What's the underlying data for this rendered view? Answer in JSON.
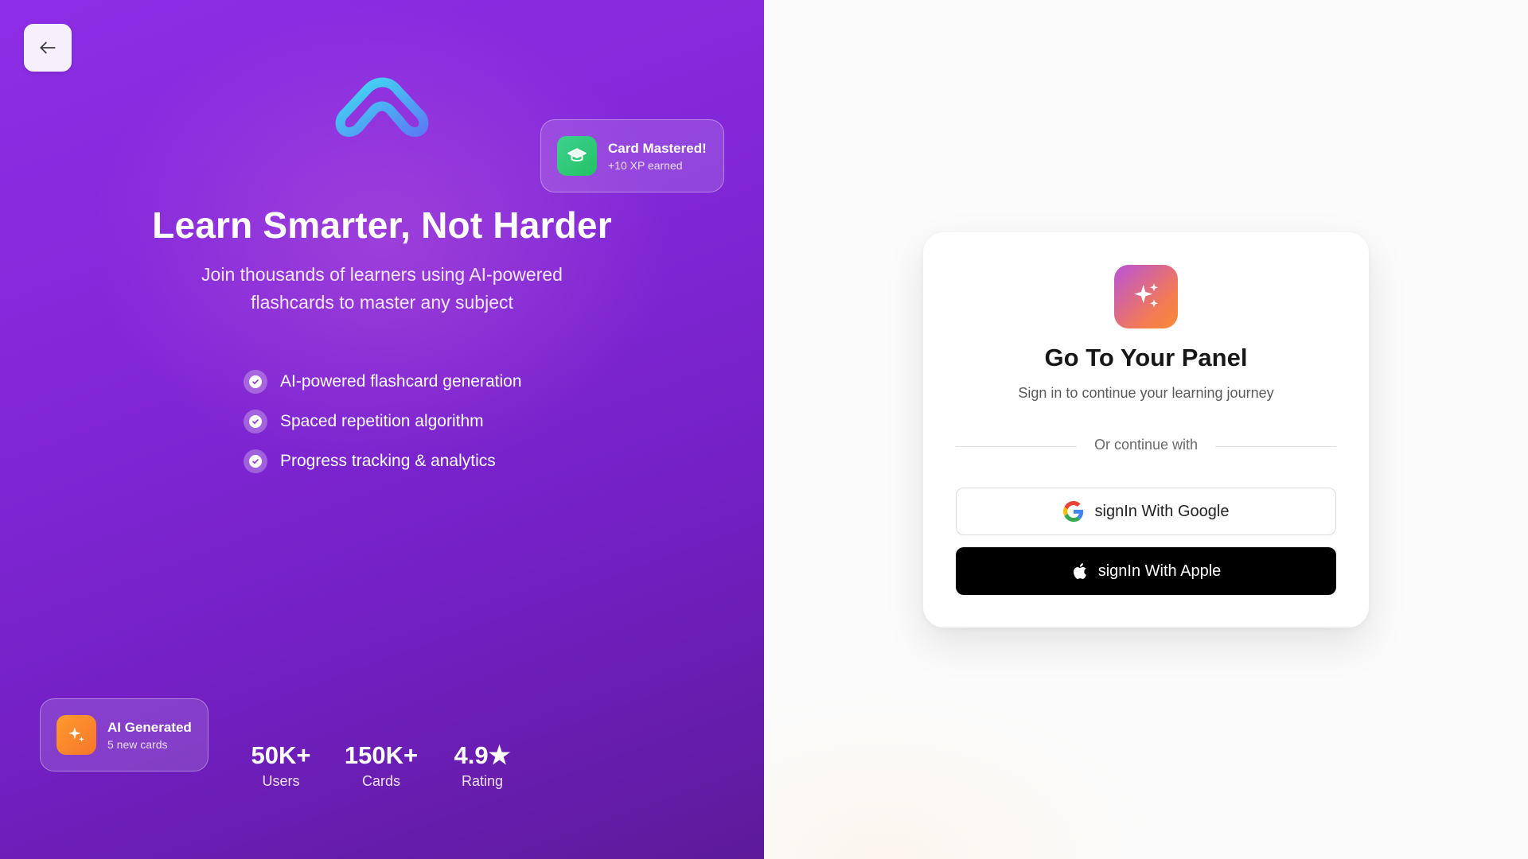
{
  "hero": {
    "headline": "Learn Smarter, Not Harder",
    "subline": "Join thousands of learners using AI-powered flashcards to master any subject",
    "features": [
      "AI-powered flashcard generation",
      "Spaced repetition algorithm",
      "Progress tracking & analytics"
    ],
    "card_mastered": {
      "title": "Card Mastered!",
      "subtitle": "+10 XP earned",
      "icon": "graduation-cap-icon"
    },
    "ai_generated": {
      "title": "AI Generated",
      "subtitle": "5 new cards",
      "icon": "sparkles-icon"
    },
    "stats": [
      {
        "value": "50K+",
        "label": "Users"
      },
      {
        "value": "150K+",
        "label": "Cards"
      },
      {
        "value": "4.9★",
        "label": "Rating"
      }
    ]
  },
  "login": {
    "title": "Go To Your Panel",
    "subtitle": "Sign in to continue your learning journey",
    "divider": "Or continue with",
    "google_label": "signIn With Google",
    "apple_label": "signIn With Apple"
  },
  "colors": {
    "hero_gradient_start": "#8d2ee6",
    "hero_gradient_end": "#5d1a9a",
    "apple_button": "#000000",
    "mastered_green": "#22c363",
    "ai_orange": "#f7762a"
  }
}
